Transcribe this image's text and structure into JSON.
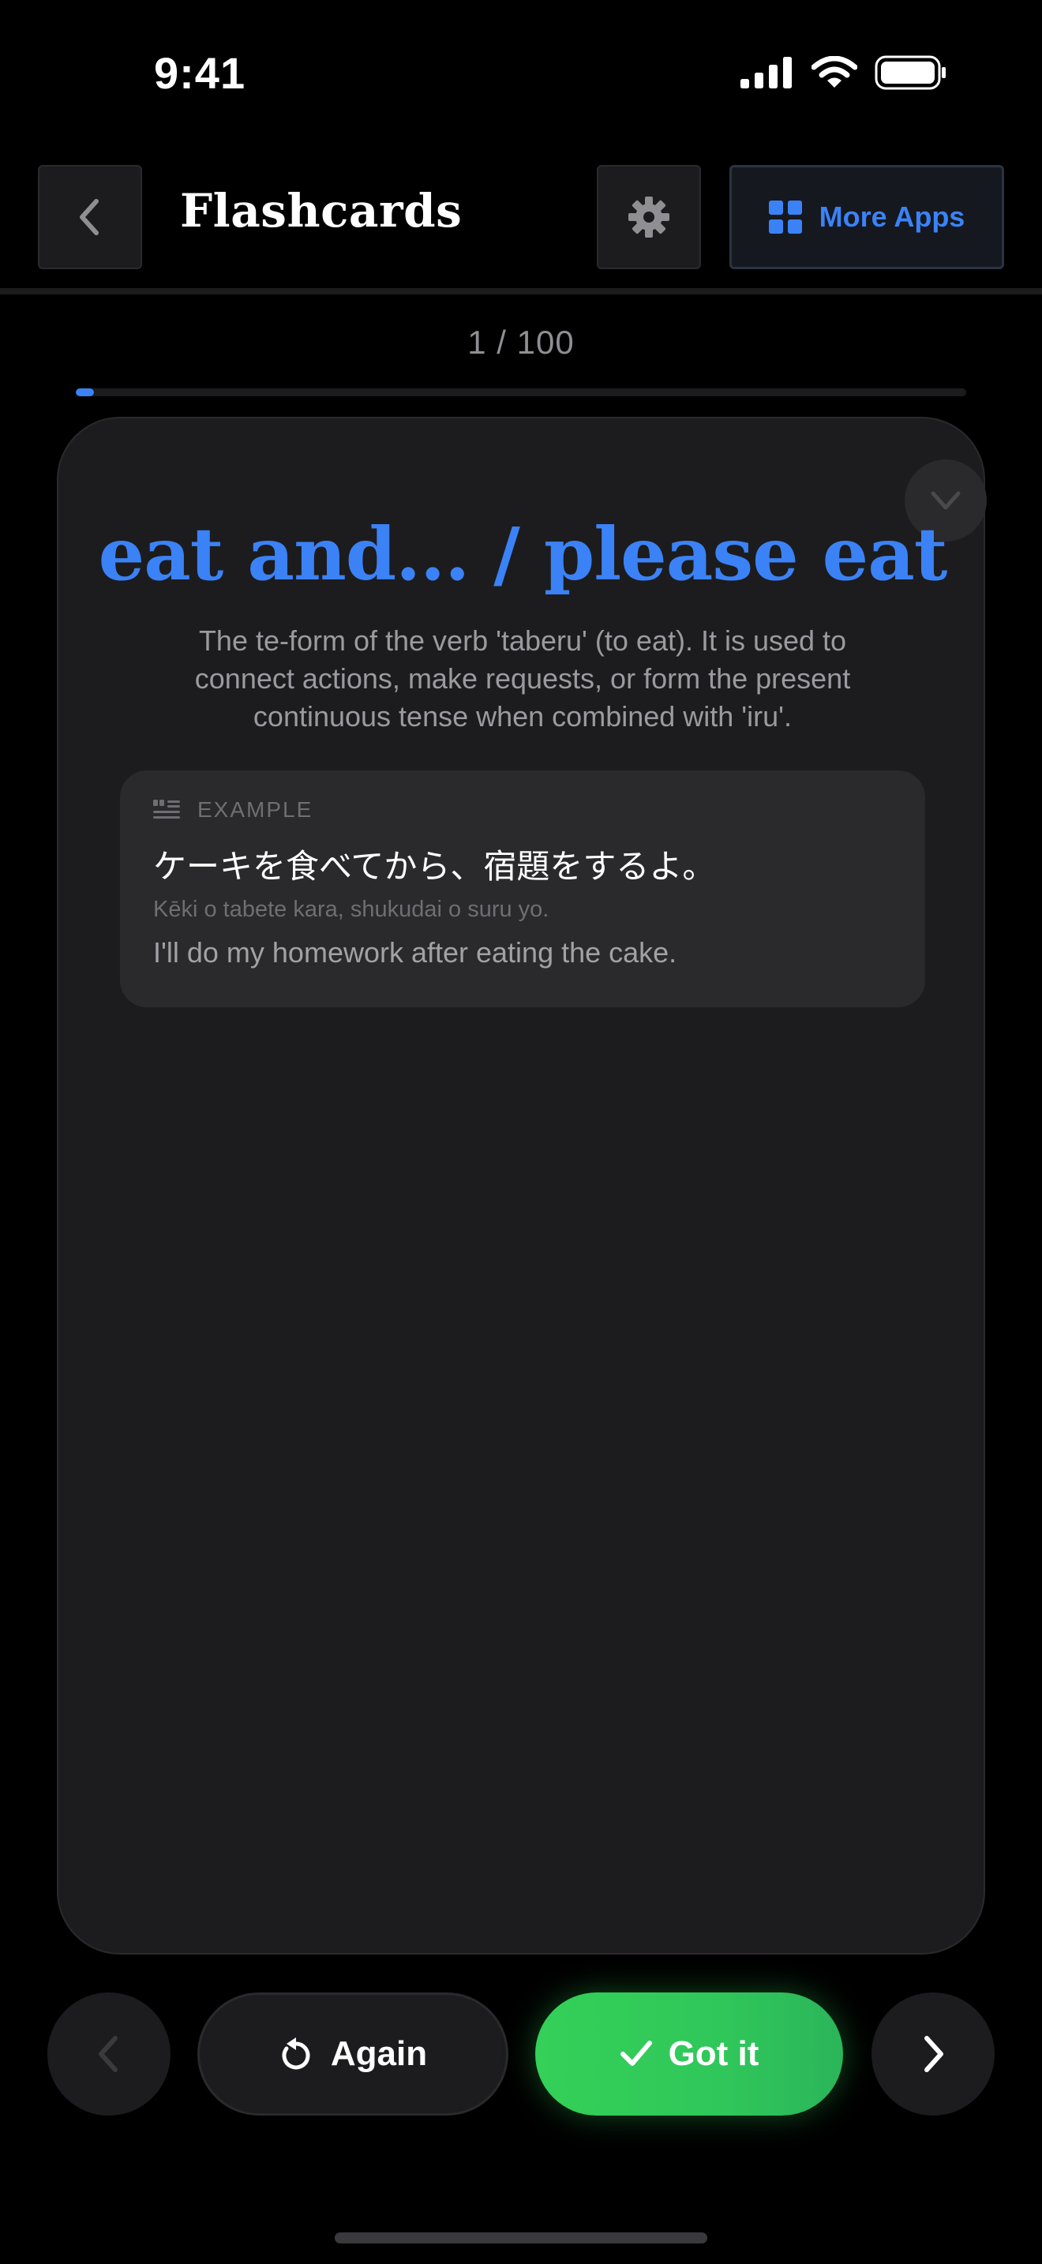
{
  "status_bar": {
    "time": "9:41"
  },
  "header": {
    "title": "Flashcards",
    "more_apps_label": "More Apps",
    "accent_color": "#3b82f6"
  },
  "progress": {
    "text": "1 / 100",
    "current": 1,
    "total": 100,
    "fraction": 0.01
  },
  "card": {
    "term": "eat and... / please eat",
    "definition": "The te-form of the verb 'taberu' (to eat). It is used to connect actions, make requests, or form the present continuous tense when combined with 'iru'.",
    "example": {
      "label": "EXAMPLE",
      "japanese": "ケーキを食べてから、宿題をするよ。",
      "romaji": "Kēki o tabete kara, shukudai o suru yo.",
      "english": "I'll do my homework after eating the cake."
    }
  },
  "controls": {
    "again_label": "Again",
    "got_it_label": "Got it",
    "got_it_color": "#34d058"
  },
  "icons": {
    "back": "chevron-left-icon",
    "settings": "gear-icon",
    "more_apps": "grid-icon",
    "collapse": "chevron-down-icon",
    "example": "quote-icon",
    "again": "refresh-icon",
    "got_it": "checkmark-icon",
    "prev": "chevron-left-icon",
    "next": "chevron-right-icon"
  }
}
